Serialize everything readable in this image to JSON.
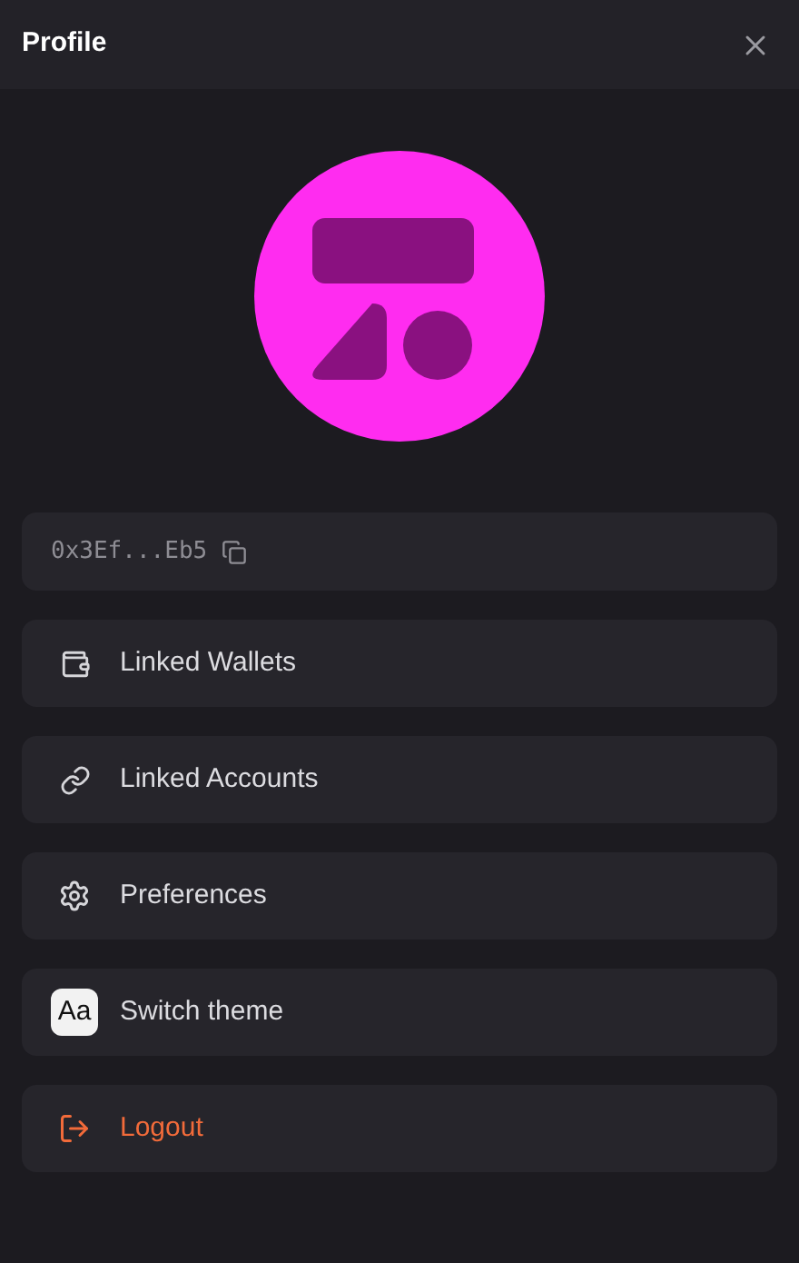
{
  "window": {
    "title": "Profile"
  },
  "address": {
    "text": "0x3Ef...Eb5"
  },
  "menu": [
    {
      "kind": "wallet",
      "label": "Linked Wallets"
    },
    {
      "kind": "link",
      "label": "Linked Accounts"
    },
    {
      "kind": "settings",
      "label": "Preferences"
    },
    {
      "kind": "theme",
      "label": "Switch theme",
      "badge": "Aa"
    },
    {
      "kind": "logout",
      "label": "Logout"
    }
  ]
}
